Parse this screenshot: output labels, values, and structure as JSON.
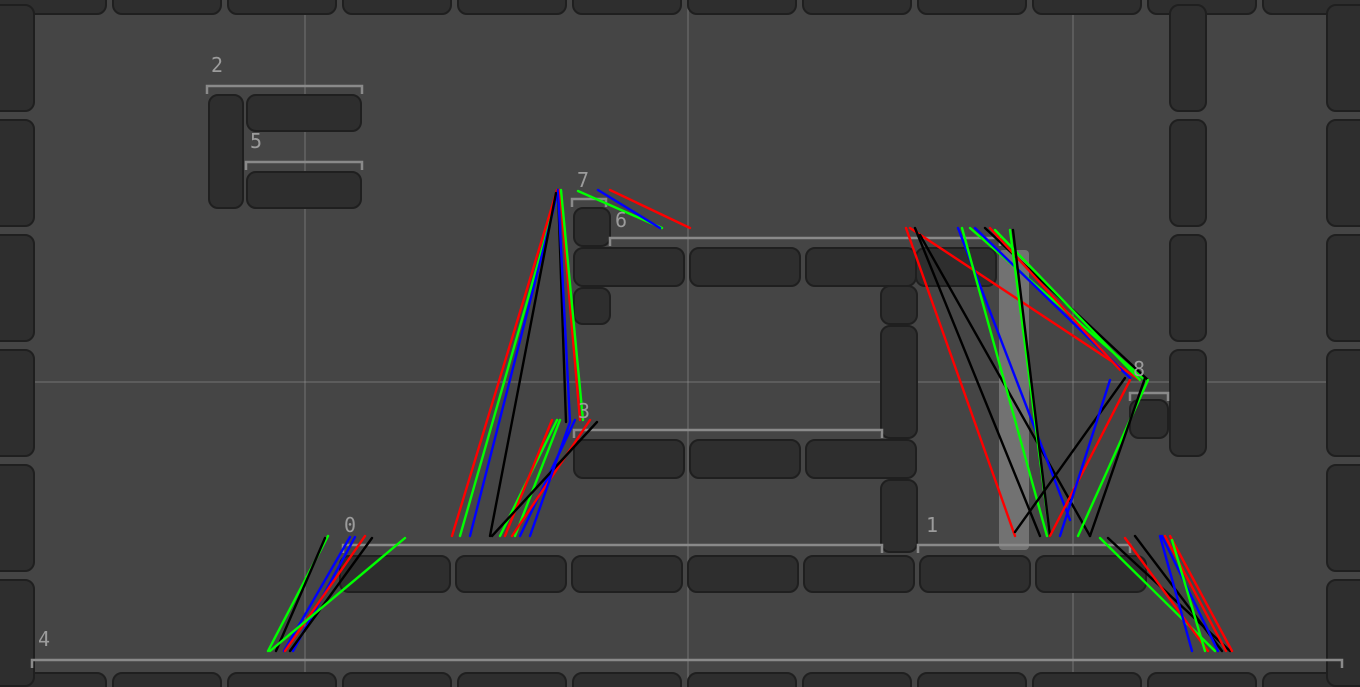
{
  "editor": {
    "colors": {
      "background": "#454545",
      "tile_fill": "#2e2e2e",
      "tile_edge": "#1f1f1f",
      "platform_outline": "#8a8a8a",
      "grid_line": "#9a9a9a",
      "label": "#9c9c9c",
      "highlight": "#7a7a7a",
      "ray_colors": [
        "#ff0000",
        "#00ff00",
        "#0000ff",
        "#000000"
      ]
    },
    "platforms": [
      {
        "id": "0",
        "label": "0"
      },
      {
        "id": "1",
        "label": "1"
      },
      {
        "id": "2",
        "label": "2"
      },
      {
        "id": "3",
        "label": "3"
      },
      {
        "id": "4",
        "label": "4"
      },
      {
        "id": "5",
        "label": "5"
      },
      {
        "id": "6",
        "label": "6"
      },
      {
        "id": "7",
        "label": "7"
      },
      {
        "id": "8",
        "label": "8"
      }
    ]
  }
}
